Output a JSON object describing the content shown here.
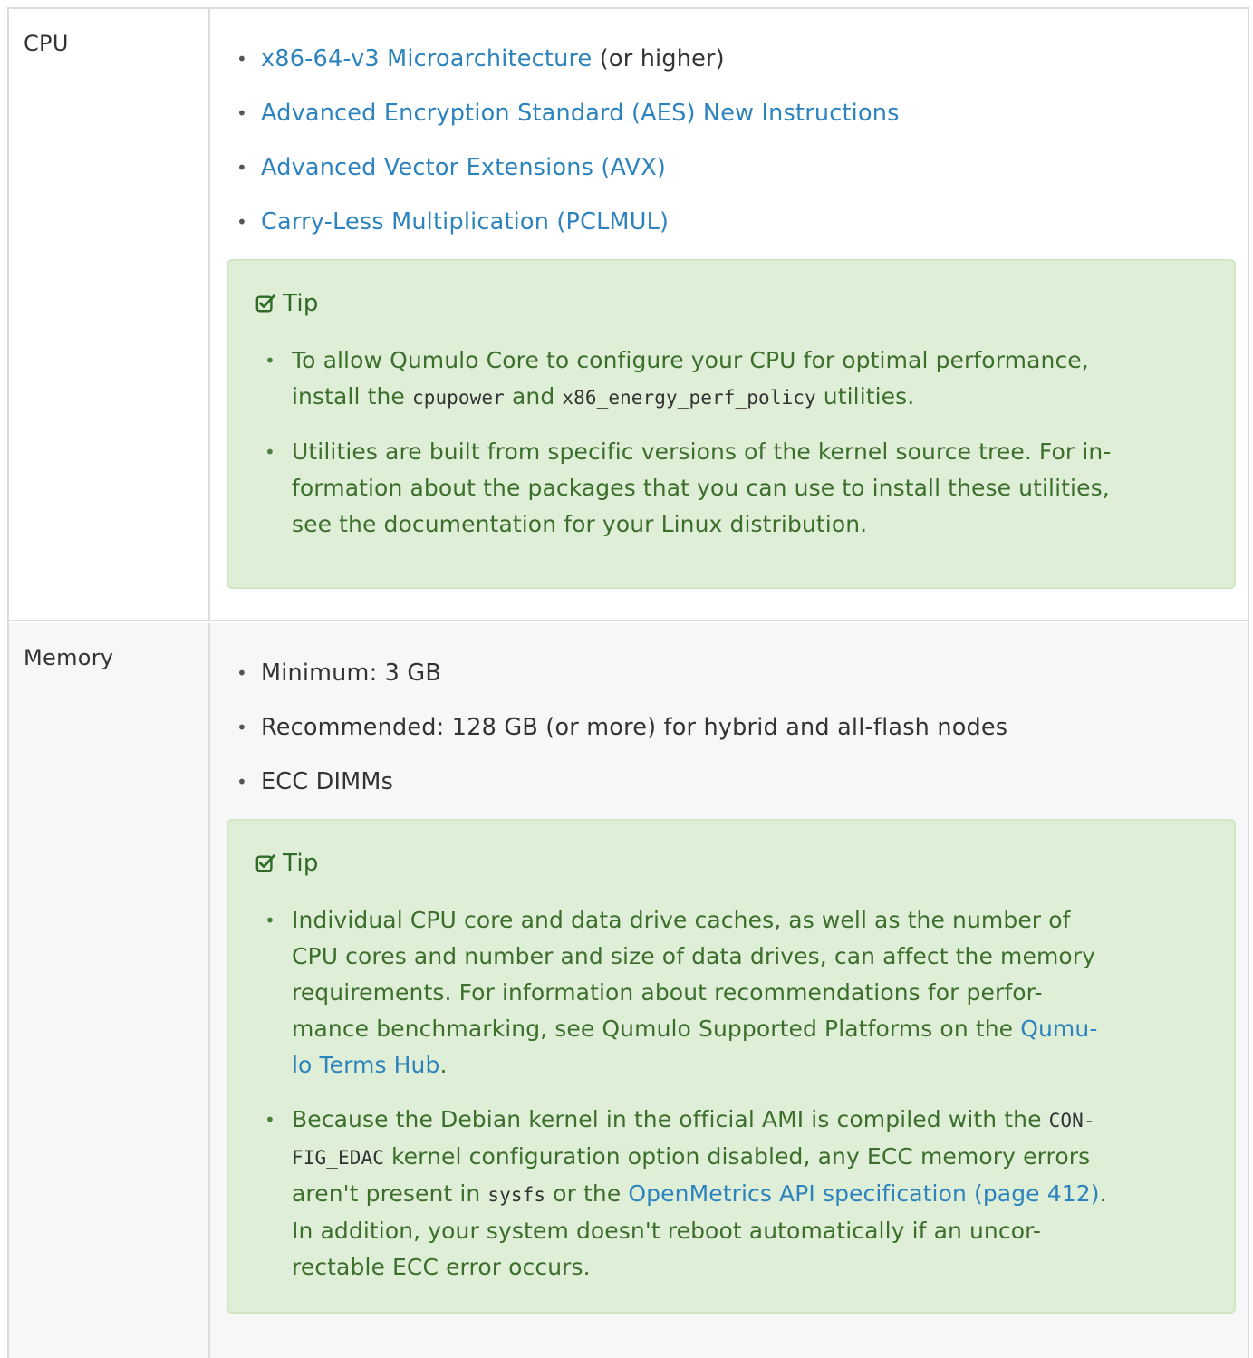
{
  "rows": [
    {
      "label": "CPU",
      "bullets": [
        {
          "link": "x86-64-v3 Microarchitecture",
          "suffix": " (or higher)"
        },
        {
          "link": "Advanced Encryption Standard (AES) New Instructions",
          "suffix": ""
        },
        {
          "link": "Advanced Vector Extensions (AVX)",
          "suffix": ""
        },
        {
          "link": "Carry-Less Multiplication (PCLMUL)",
          "suffix": ""
        }
      ],
      "tip": {
        "title": "Tip",
        "items": [
          {
            "lines": [
              [
                {
                  "t": "To allow Qumulo Core to configure your CPU for optimal performance,"
                }
              ],
              [
                {
                  "t": "install the "
                },
                {
                  "code": "cpupower"
                },
                {
                  "t": " and "
                },
                {
                  "code": "x86_energy_perf_policy"
                },
                {
                  "t": " utilities."
                }
              ]
            ]
          },
          {
            "lines": [
              [
                {
                  "t": "Utilities are built from specific versions of the kernel source tree. For in-"
                }
              ],
              [
                {
                  "t": "formation about the packages that you can use to install these utilities,"
                }
              ],
              [
                {
                  "t": "see the documentation for your Linux distribution."
                }
              ]
            ]
          }
        ]
      }
    },
    {
      "label": "Memory",
      "bullets": [
        {
          "text": "Minimum: 3 GB"
        },
        {
          "text": "Recommended: 128 GB (or more) for hybrid and all-flash nodes"
        },
        {
          "text": "ECC DIMMs"
        }
      ],
      "tip": {
        "title": "Tip",
        "items": [
          {
            "lines": [
              [
                {
                  "t": "Individual CPU core and data drive caches, as well as the number of"
                }
              ],
              [
                {
                  "t": "CPU cores and number and size of data drives, can affect the memory"
                }
              ],
              [
                {
                  "t": "requirements. For information about recommendations for perfor-"
                }
              ],
              [
                {
                  "t": "mance benchmarking, see Qumulo Supported Platforms on the "
                },
                {
                  "link": "Qumu-"
                }
              ],
              [
                {
                  "link": "lo Terms Hub"
                },
                {
                  "t": "."
                }
              ]
            ]
          },
          {
            "lines": [
              [
                {
                  "t": "Because the Debian kernel in the official AMI is compiled with the "
                },
                {
                  "code": "CON-"
                }
              ],
              [
                {
                  "code": "FIG_EDAC"
                },
                {
                  "t": " kernel configuration option disabled, any ECC memory errors"
                }
              ],
              [
                {
                  "t": "aren't present in "
                },
                {
                  "code": "sysfs"
                },
                {
                  "t": " or the "
                },
                {
                  "link": "OpenMetrics API specification (page 412)"
                },
                {
                  "t": "."
                }
              ],
              [
                {
                  "t": "In addition, your system doesn't reboot automatically if an uncor-"
                }
              ],
              [
                {
                  "t": "rectable ECC error occurs."
                }
              ]
            ]
          }
        ]
      }
    }
  ]
}
